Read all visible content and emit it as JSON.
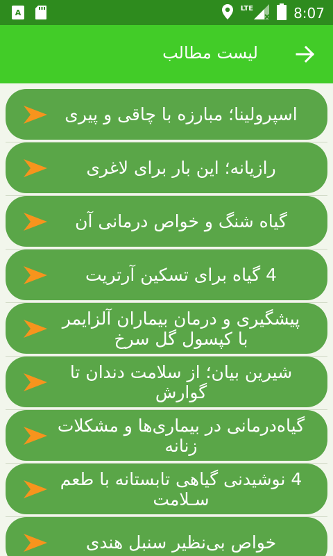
{
  "status_bar": {
    "time": "8:07",
    "network": "LTE",
    "icons": [
      "accessibility-icon",
      "sd-card-icon",
      "location-icon",
      "signal-icon",
      "battery-icon"
    ]
  },
  "app_bar": {
    "title": "لیست مطالب",
    "back_icon": "arrow-right-icon"
  },
  "colors": {
    "status_bar": "#2e8b1e",
    "app_bar": "#42cc28",
    "item_background": "#5aa648",
    "arrow": "#f7941d",
    "page_background": "#f2f6ec"
  },
  "items": [
    {
      "label": "اسپرولینا؛ مبارزه با چاقی و پیری"
    },
    {
      "label": "رازیانه؛ این بار برای لاغری"
    },
    {
      "label": "گیاه شنگ و خواص درمانی آن"
    },
    {
      "label": "4 گیاه برای تسکین آرتریت"
    },
    {
      "label": "پیشگیری و درمان بیماران آلزایمر با کپسول گل سرخ"
    },
    {
      "label": "شیرین بیان؛ از سلامت دندان تا گوارش"
    },
    {
      "label": "گیاه‌درمانی در بیماری‌ها و مشکلات زنانه"
    },
    {
      "label": "4 نوشیدنی گیاهی تابستانه با طعم سـلامت"
    },
    {
      "label": "خواص بی‌نظیر سنبل هندی"
    }
  ]
}
